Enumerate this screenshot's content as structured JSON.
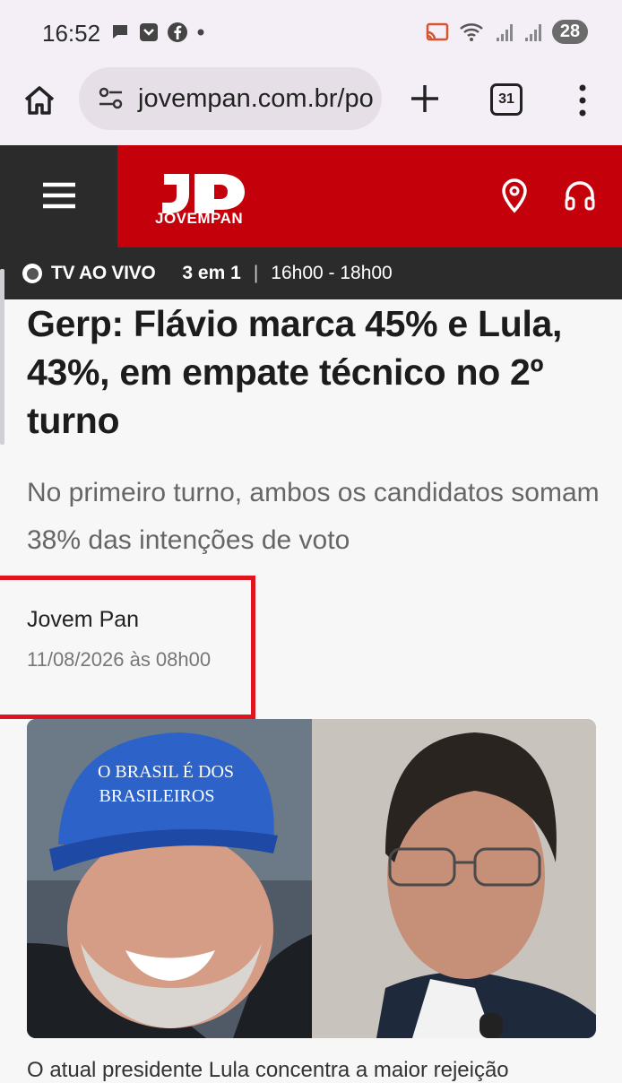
{
  "status_bar": {
    "time": "16:52",
    "battery": "28",
    "left_icons": [
      "chat-icon",
      "pocket-icon",
      "facebook-icon",
      "dot-icon"
    ],
    "right_icons": [
      "cast-icon",
      "wifi-icon",
      "signal-icon",
      "signal-icon",
      "battery-icon"
    ]
  },
  "browser": {
    "url": "jovempan.com.br/po",
    "tab_count": "31"
  },
  "site": {
    "brand": "JOVEMPAN",
    "brand_color": "#c4000b",
    "live": {
      "label": "TV AO VIVO",
      "program": "3 em 1",
      "separator": "|",
      "time": "16h00 - 18h00"
    }
  },
  "article": {
    "headline": "Gerp: Flávio marca 45% e Lula, 43%, em empate técnico no 2º turno",
    "subhead": "No primeiro turno, ambos os candidatos somam 38% das intenções de voto",
    "author": "Jovem Pan",
    "date": "11/08/2026 às 08h00",
    "image_text": "O BRASIL É DOS BRASILEIROS",
    "caption": "O atual presidente Lula concentra a maior rejeição"
  }
}
